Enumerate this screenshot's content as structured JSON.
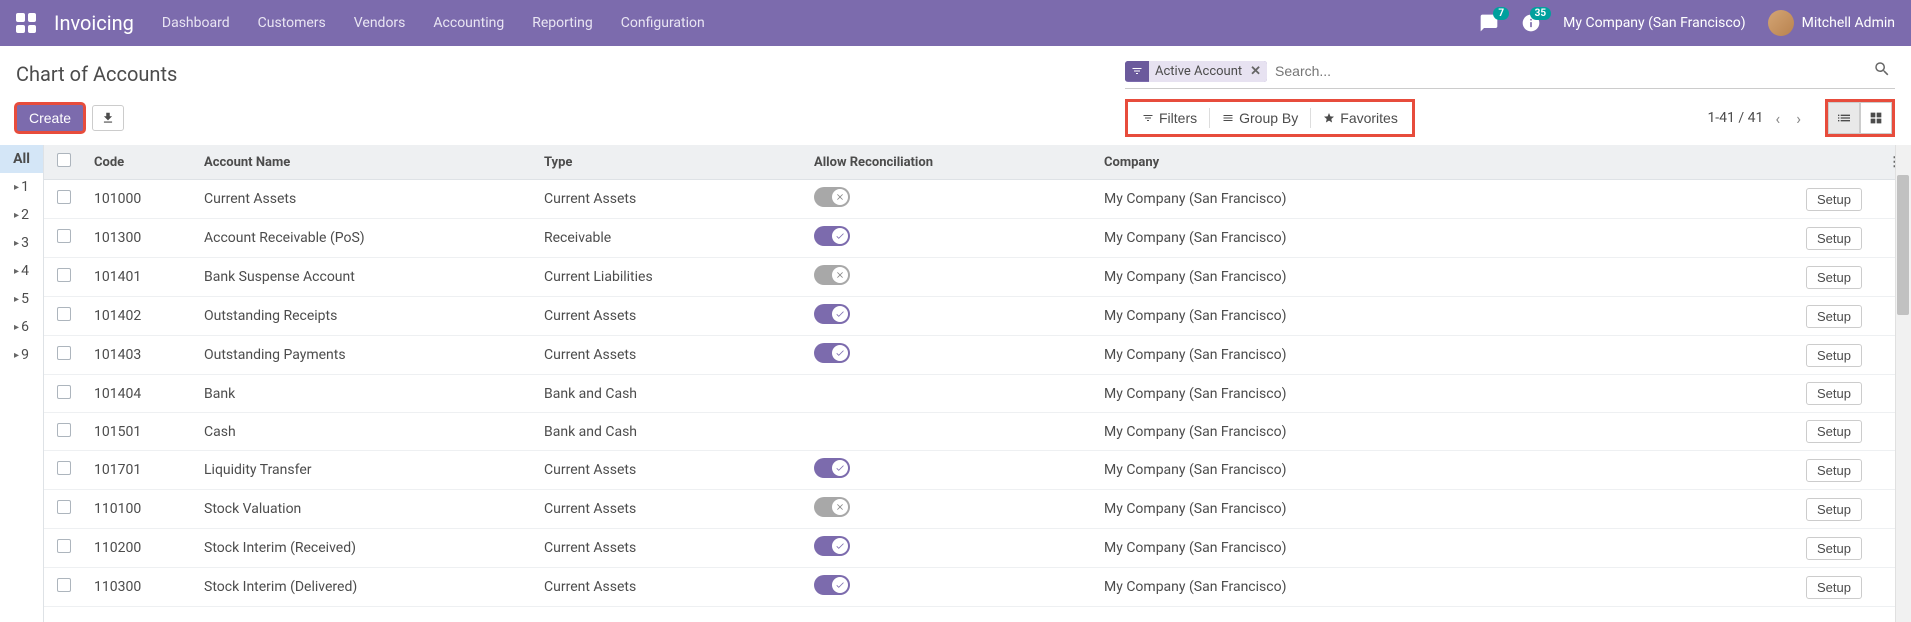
{
  "navbar": {
    "brand": "Invoicing",
    "links": [
      "Dashboard",
      "Customers",
      "Vendors",
      "Accounting",
      "Reporting",
      "Configuration"
    ],
    "messages_count": "7",
    "activities_count": "35",
    "company": "My Company (San Francisco)",
    "user": "Mitchell Admin"
  },
  "breadcrumb": {
    "title": "Chart of Accounts"
  },
  "search": {
    "facet_label": "Active Account",
    "placeholder": "Search...",
    "filters_label": "Filters",
    "groupby_label": "Group By",
    "favorites_label": "Favorites"
  },
  "buttons": {
    "create": "Create",
    "setup": "Setup"
  },
  "pager": {
    "range": "1-41 / 41"
  },
  "side_tabs": [
    "All",
    "1",
    "2",
    "3",
    "4",
    "5",
    "6",
    "9"
  ],
  "table": {
    "headers": {
      "code": "Code",
      "name": "Account Name",
      "type": "Type",
      "recon": "Allow Reconciliation",
      "company": "Company"
    },
    "rows": [
      {
        "code": "101000",
        "name": "Current Assets",
        "type": "Current Assets",
        "recon": false,
        "company": "My Company (San Francisco)"
      },
      {
        "code": "101300",
        "name": "Account Receivable (PoS)",
        "type": "Receivable",
        "recon": true,
        "company": "My Company (San Francisco)"
      },
      {
        "code": "101401",
        "name": "Bank Suspense Account",
        "type": "Current Liabilities",
        "recon": false,
        "company": "My Company (San Francisco)"
      },
      {
        "code": "101402",
        "name": "Outstanding Receipts",
        "type": "Current Assets",
        "recon": true,
        "company": "My Company (San Francisco)"
      },
      {
        "code": "101403",
        "name": "Outstanding Payments",
        "type": "Current Assets",
        "recon": true,
        "company": "My Company (San Francisco)"
      },
      {
        "code": "101404",
        "name": "Bank",
        "type": "Bank and Cash",
        "recon": null,
        "company": "My Company (San Francisco)"
      },
      {
        "code": "101501",
        "name": "Cash",
        "type": "Bank and Cash",
        "recon": null,
        "company": "My Company (San Francisco)"
      },
      {
        "code": "101701",
        "name": "Liquidity Transfer",
        "type": "Current Assets",
        "recon": true,
        "company": "My Company (San Francisco)"
      },
      {
        "code": "110100",
        "name": "Stock Valuation",
        "type": "Current Assets",
        "recon": false,
        "company": "My Company (San Francisco)"
      },
      {
        "code": "110200",
        "name": "Stock Interim (Received)",
        "type": "Current Assets",
        "recon": true,
        "company": "My Company (San Francisco)"
      },
      {
        "code": "110300",
        "name": "Stock Interim (Delivered)",
        "type": "Current Assets",
        "recon": true,
        "company": "My Company (San Francisco)"
      }
    ]
  }
}
